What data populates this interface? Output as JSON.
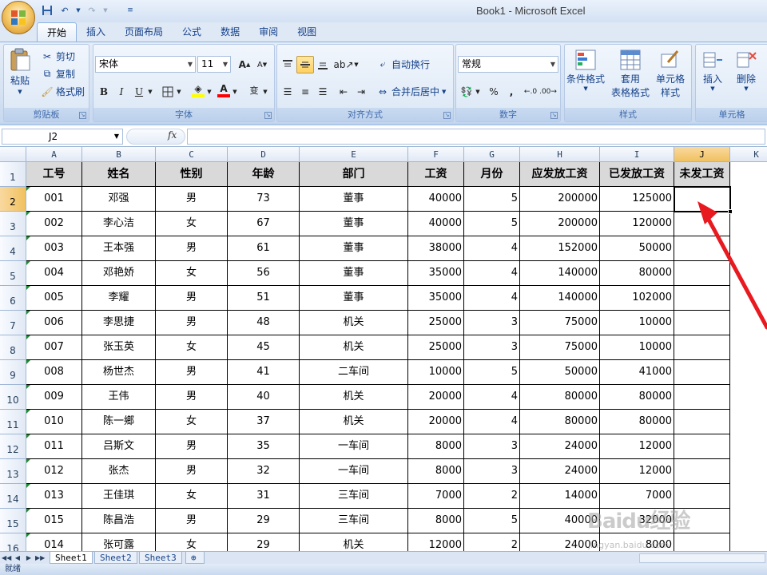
{
  "window": {
    "title": "Book1 - Microsoft Excel"
  },
  "tabs": [
    "开始",
    "插入",
    "页面布局",
    "公式",
    "数据",
    "审阅",
    "视图"
  ],
  "ribbon": {
    "clipboard": {
      "label": "剪贴板",
      "paste": "粘贴",
      "cut": "剪切",
      "copy": "复制",
      "format_painter": "格式刷"
    },
    "font": {
      "label": "字体",
      "name": "宋体",
      "size": "11",
      "bold": "B",
      "italic": "I",
      "underline": "U"
    },
    "alignment": {
      "label": "对齐方式",
      "wrap": "自动换行",
      "merge": "合并后居中"
    },
    "number": {
      "label": "数字",
      "format": "常规",
      "percent": "%",
      "comma": ","
    },
    "styles": {
      "label": "样式",
      "conditional": "条件格式",
      "table_line1": "套用",
      "table_line2": "表格格式",
      "cell_line1": "单元格",
      "cell_line2": "样式"
    },
    "cells": {
      "label": "单元格",
      "insert": "插入",
      "delete": "删除"
    }
  },
  "formula_bar": {
    "name_box": "J2",
    "fx": "fx",
    "formula": ""
  },
  "columns": [
    "A",
    "B",
    "C",
    "D",
    "E",
    "F",
    "G",
    "H",
    "I",
    "J",
    "K"
  ],
  "row_numbers": [
    "1",
    "2",
    "3",
    "4",
    "5",
    "6",
    "7",
    "8",
    "9",
    "10",
    "11",
    "12",
    "13",
    "14",
    "15",
    "16"
  ],
  "headers": [
    "工号",
    "姓名",
    "性别",
    "年龄",
    "部门",
    "工资",
    "月份",
    "应发放工资",
    "已发放工资",
    "未发工资"
  ],
  "rows": [
    [
      "001",
      "邓强",
      "男",
      "73",
      "董事",
      "40000",
      "5",
      "200000",
      "125000",
      ""
    ],
    [
      "002",
      "李心洁",
      "女",
      "67",
      "董事",
      "40000",
      "5",
      "200000",
      "120000",
      ""
    ],
    [
      "003",
      "王本强",
      "男",
      "61",
      "董事",
      "38000",
      "4",
      "152000",
      "50000",
      ""
    ],
    [
      "004",
      "邓艳娇",
      "女",
      "56",
      "董事",
      "35000",
      "4",
      "140000",
      "80000",
      ""
    ],
    [
      "005",
      "李耀",
      "男",
      "51",
      "董事",
      "35000",
      "4",
      "140000",
      "102000",
      ""
    ],
    [
      "006",
      "李思捷",
      "男",
      "48",
      "机关",
      "25000",
      "3",
      "75000",
      "10000",
      ""
    ],
    [
      "007",
      "张玉英",
      "女",
      "45",
      "机关",
      "25000",
      "3",
      "75000",
      "10000",
      ""
    ],
    [
      "008",
      "杨世杰",
      "男",
      "41",
      "二车间",
      "10000",
      "5",
      "50000",
      "41000",
      ""
    ],
    [
      "009",
      "王伟",
      "男",
      "40",
      "机关",
      "20000",
      "4",
      "80000",
      "80000",
      ""
    ],
    [
      "010",
      "陈一鄉",
      "女",
      "37",
      "机关",
      "20000",
      "4",
      "80000",
      "80000",
      ""
    ],
    [
      "011",
      "吕斯文",
      "男",
      "35",
      "一车间",
      "8000",
      "3",
      "24000",
      "12000",
      ""
    ],
    [
      "012",
      "张杰",
      "男",
      "32",
      "一车间",
      "8000",
      "3",
      "24000",
      "12000",
      ""
    ],
    [
      "013",
      "王佳琪",
      "女",
      "31",
      "三车间",
      "7000",
      "2",
      "14000",
      "7000",
      ""
    ],
    [
      "015",
      "陈昌浩",
      "男",
      "29",
      "三车间",
      "8000",
      "5",
      "40000",
      "32000",
      ""
    ],
    [
      "014",
      "张可露",
      "女",
      "29",
      "机关",
      "12000",
      "2",
      "24000",
      "8000",
      ""
    ]
  ],
  "sheets": [
    "Sheet1",
    "Sheet2",
    "Sheet3"
  ],
  "status": "就绪",
  "watermark": {
    "brand": "Baidu经验",
    "url": "jingyan.baidu.com"
  },
  "colors": {
    "arrow": "#e8191f",
    "header_fill": "#d9d9d9",
    "active_header": "#f1c15f"
  },
  "icons": [
    "office-logo-icon",
    "save-icon",
    "undo-icon",
    "redo-icon",
    "paste-icon",
    "scissors-icon",
    "copy-icon",
    "brush-icon",
    "grow-font-icon",
    "shrink-font-icon",
    "border-icon",
    "fill-color-icon",
    "font-color-icon",
    "phonetic-icon",
    "align-top-icon",
    "align-middle-icon",
    "align-bottom-icon",
    "orientation-icon",
    "wrap-text-icon",
    "merge-icon",
    "currency-icon",
    "increase-decimal-icon",
    "decrease-decimal-icon",
    "conditional-format-icon",
    "table-format-icon",
    "cell-styles-icon",
    "insert-cells-icon",
    "delete-cells-icon",
    "red-arrow-annotation"
  ]
}
